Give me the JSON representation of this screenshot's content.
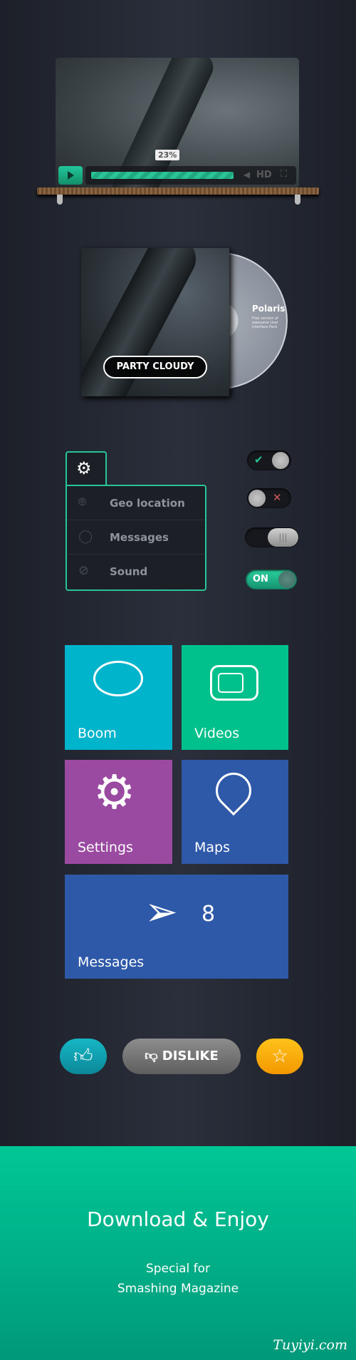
{
  "video": {
    "progress_percent": 23,
    "progress_label": "23%",
    "hd_label": "HD",
    "play": "play-icon",
    "volume": "volume-icon",
    "fullscreen": "fullscreen-icon"
  },
  "album": {
    "button": "PARTY CLOUDY",
    "disc_title": "Polaris",
    "disc_text": "Free version of awesome User Interface Pack"
  },
  "settings": {
    "items": [
      {
        "label": "Geo location",
        "icon": "map-pin-icon"
      },
      {
        "label": "Messages",
        "icon": "speech-bubble-icon"
      },
      {
        "label": "Sound",
        "icon": "sound-off-icon"
      }
    ]
  },
  "toggles": {
    "on_label": "ON",
    "states": [
      "on",
      "off",
      "off",
      "on"
    ]
  },
  "tiles": [
    {
      "label": "Boom",
      "color": "#00b4cc"
    },
    {
      "label": "Videos",
      "color": "#00c08b"
    },
    {
      "label": "Settings",
      "color": "#9a4aa0"
    },
    {
      "label": "Maps",
      "color": "#2e59a8"
    },
    {
      "label": "Messages",
      "count": "8",
      "color": "#2e59a8"
    }
  ],
  "buttons": {
    "dislike": "DISLIKE",
    "like_color": "#12a6b5",
    "star_color": "#f7a600"
  },
  "footer": {
    "title": "Download & Enjoy",
    "line1": "Special for",
    "line2": "Smashing Magazine",
    "watermark": "Tuyiyi.com"
  },
  "accent": "#27c497"
}
